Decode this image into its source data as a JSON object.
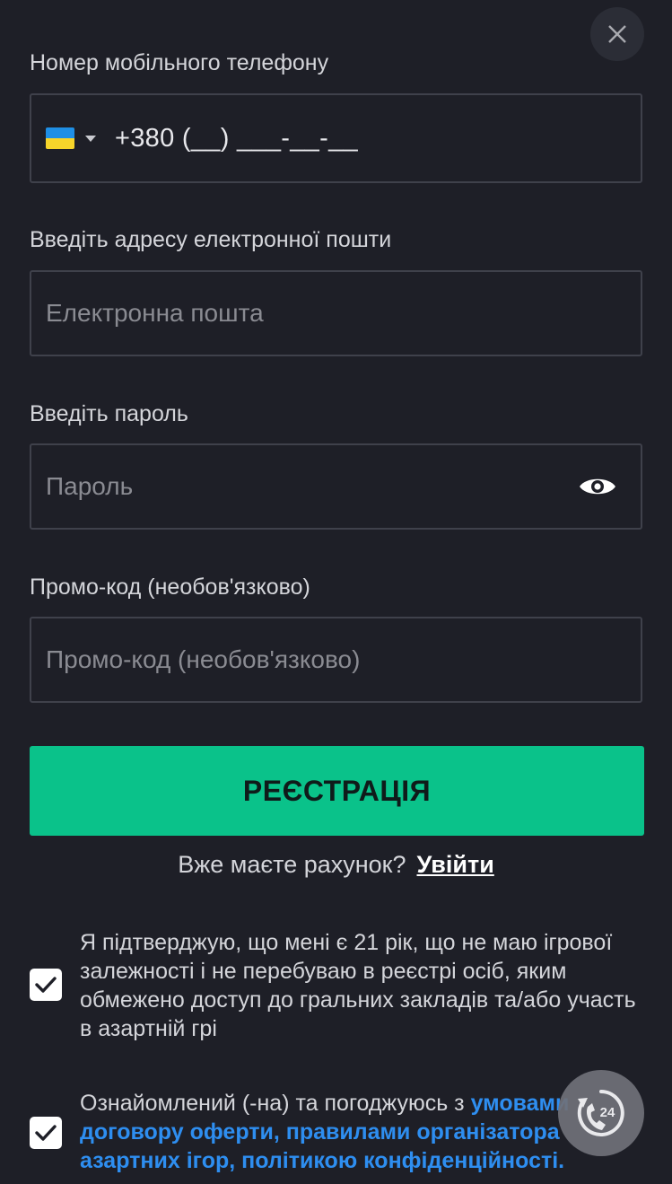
{
  "close_label": "×",
  "phone": {
    "label": "Номер мобільного телефону",
    "country_flag": "flag-ukraine-icon",
    "value": "+380 (__) ___-__-__"
  },
  "email": {
    "label": "Введіть адресу електронної пошти",
    "placeholder": "Електронна пошта"
  },
  "password": {
    "label": "Введіть пароль",
    "placeholder": "Пароль"
  },
  "promo": {
    "label": "Промо-код (необов'язково)",
    "placeholder": "Промо-код (необов'язково)"
  },
  "register_button": "РЕЄСТРАЦІЯ",
  "login": {
    "question": "Вже маєте рахунок?",
    "link": "Увійти"
  },
  "consent_age": {
    "checked": true,
    "text": "Я підтверджую, що мені є 21 рік, що не маю ігрової залежності і не перебуваю в реєстрі осіб, яким обмежено доступ до гральних закладів та/або участь в азартній грі"
  },
  "consent_terms": {
    "checked": true,
    "text_prefix": "Ознайомлений (-на) та погоджуюсь з ",
    "link_text": "умовами договору оферти, правилами організатора азартних ігор, політикою конфіденційності."
  },
  "support_badge": "24",
  "colors": {
    "background": "#1e1f27",
    "accent_green": "#0ac28a",
    "link_blue": "#2e8ef0",
    "field_border": "#3f414b"
  }
}
